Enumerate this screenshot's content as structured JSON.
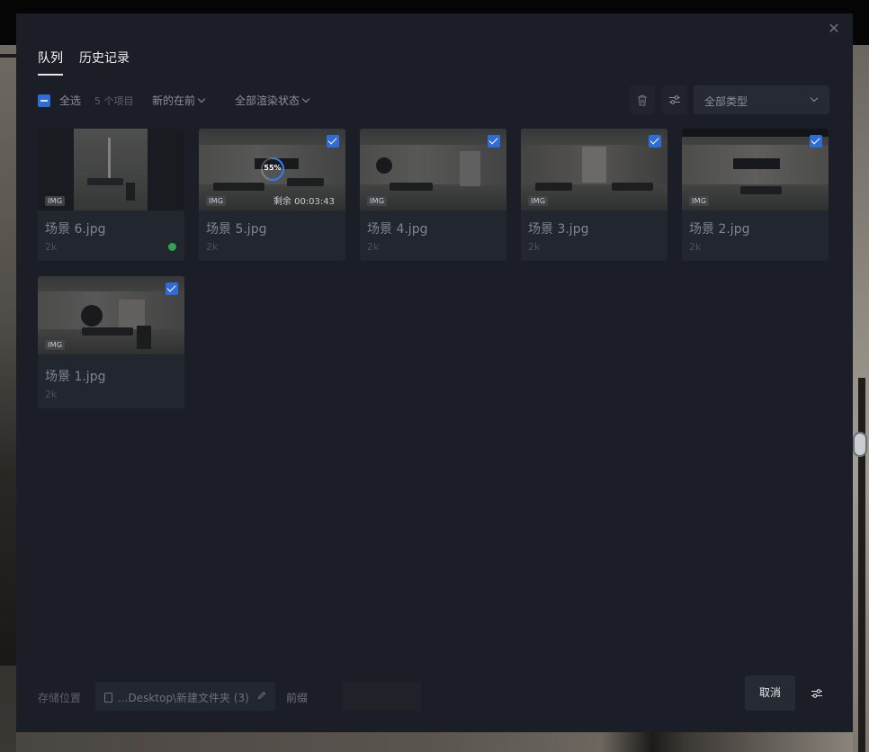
{
  "tabs": [
    {
      "label": "队列",
      "active": true
    },
    {
      "label": "历史记录",
      "active": false
    }
  ],
  "toolbar": {
    "select_all_label": "全选",
    "items_count": "5 个项目",
    "sort_label": "新的在前",
    "render_state_label": "全部渲染状态",
    "type_filter_label": "全部类型"
  },
  "cards": [
    {
      "name": "场景 6.jpg",
      "resolution": "2k",
      "badge": "IMG",
      "checked": false,
      "status": "done"
    },
    {
      "name": "场景 5.jpg",
      "resolution": "2k",
      "badge": "IMG",
      "checked": true,
      "status": "rendering",
      "progress": 55,
      "progress_label": "55%",
      "remaining": "剩余 00:03:43"
    },
    {
      "name": "场景 4.jpg",
      "resolution": "2k",
      "badge": "IMG",
      "checked": true,
      "status": "queued"
    },
    {
      "name": "场景 3.jpg",
      "resolution": "2k",
      "badge": "IMG",
      "checked": true,
      "status": "queued"
    },
    {
      "name": "场景 2.jpg",
      "resolution": "2k",
      "badge": "IMG",
      "checked": true,
      "status": "queued"
    },
    {
      "name": "场景 1.jpg",
      "resolution": "2k",
      "badge": "IMG",
      "checked": true,
      "status": "queued"
    }
  ],
  "footer": {
    "save_location_label": "存储位置",
    "save_path": "...Desktop\\新建文件夹 (3)",
    "prefix_label": "前缀",
    "prefix_value": "",
    "cancel_label": "取消"
  },
  "colors": {
    "modal_bg": "#1b1e26",
    "card_bg": "#22262e",
    "accent": "#2f6dd6",
    "done": "#2ea44f"
  },
  "icons": [
    "close-icon",
    "trash-icon",
    "filter-sliders-icon",
    "chevron-down-icon",
    "file-icon",
    "pencil-icon",
    "settings-sliders-icon",
    "checkmark-icon"
  ]
}
